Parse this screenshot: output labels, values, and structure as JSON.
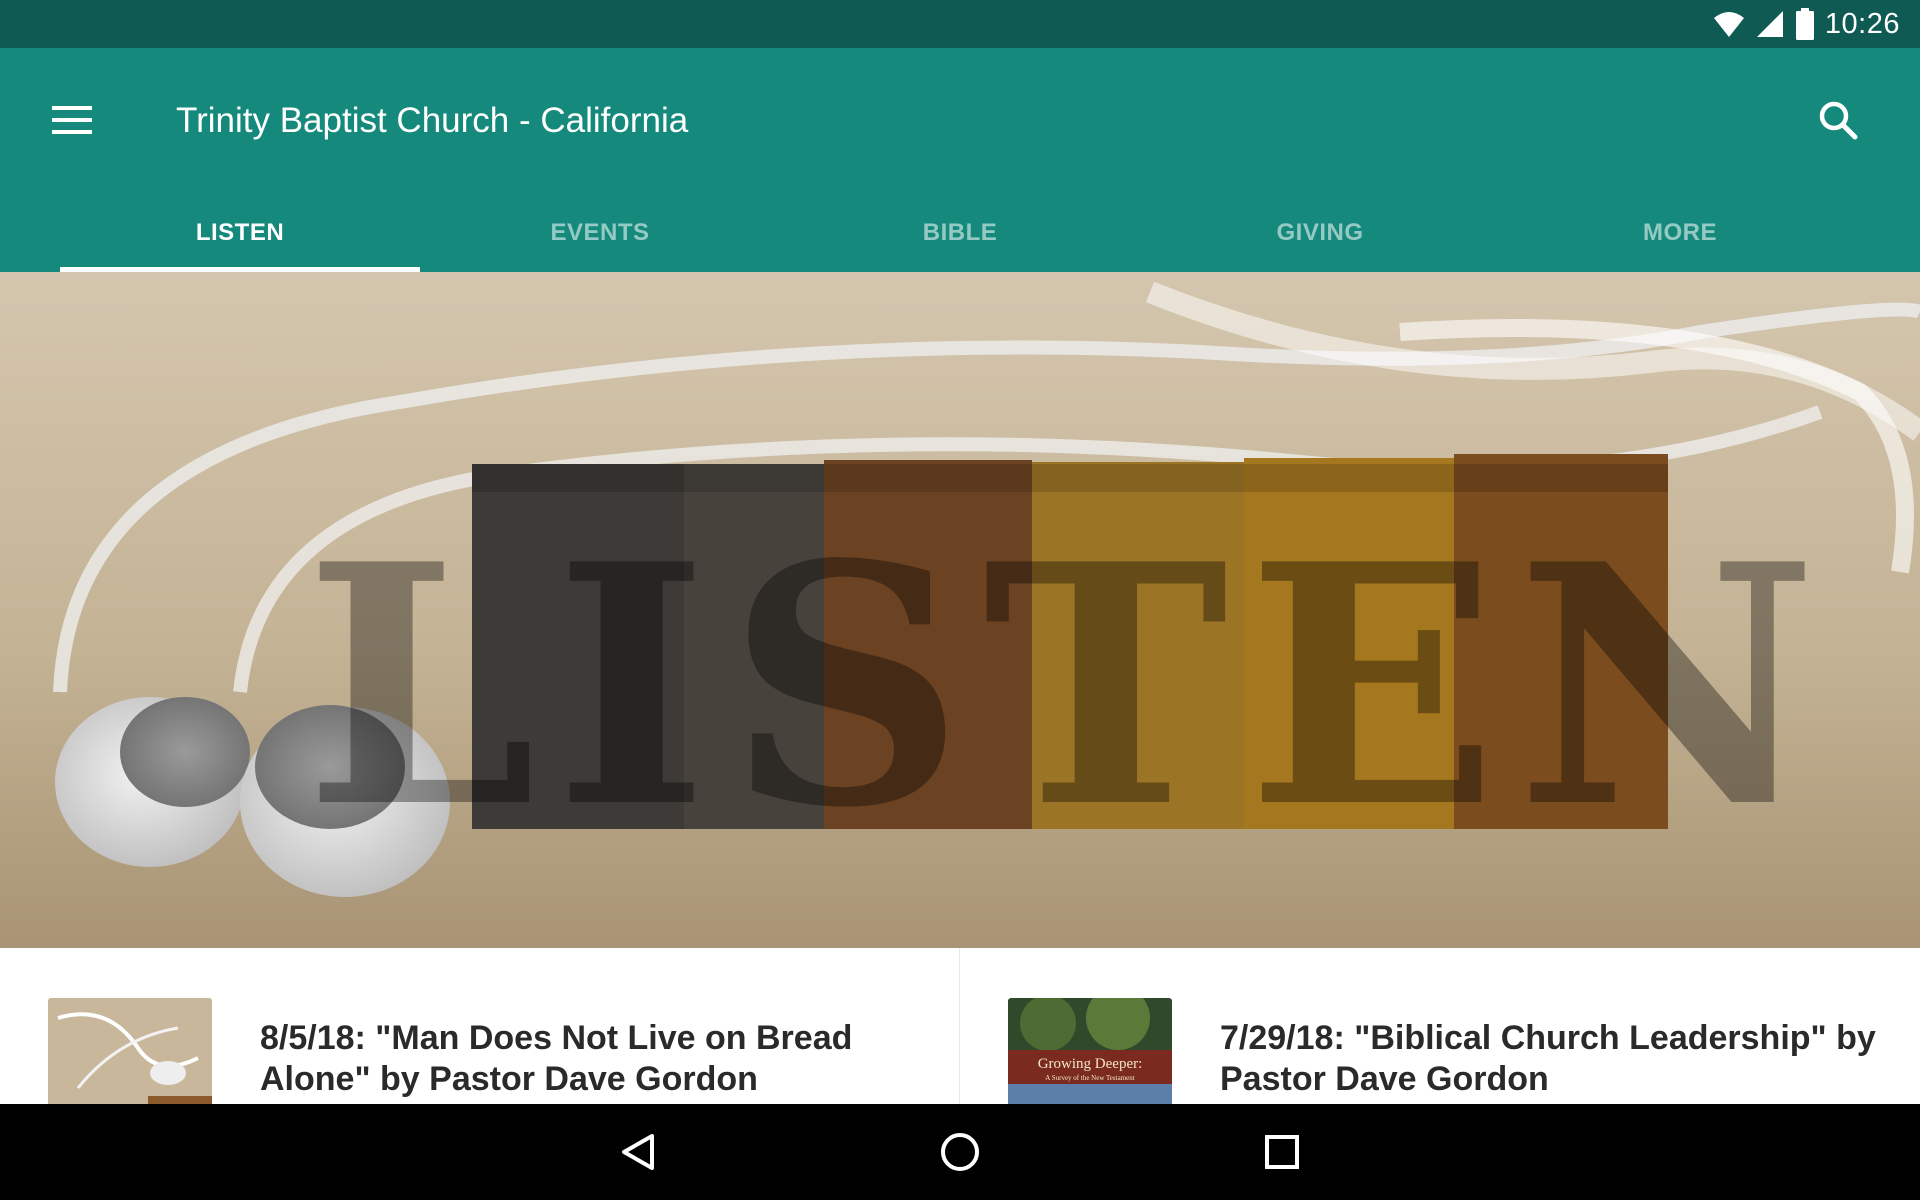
{
  "status_bar": {
    "time": "10:26",
    "icons": [
      "wifi-icon",
      "signal-icon",
      "battery-icon"
    ]
  },
  "app_bar": {
    "title": "Trinity Baptist Church - California",
    "menu_icon": "hamburger-menu-icon",
    "search_icon": "search-icon"
  },
  "tabs": [
    {
      "label": "LISTEN",
      "active": true
    },
    {
      "label": "EVENTS",
      "active": false
    },
    {
      "label": "BIBLE",
      "active": false
    },
    {
      "label": "GIVING",
      "active": false
    },
    {
      "label": "MORE",
      "active": false
    }
  ],
  "hero": {
    "word": "LISTEN"
  },
  "sermons": [
    {
      "title": "8/5/18: \"Man Does Not Live on Bread Alone\" by Pastor Dave Gordon"
    },
    {
      "title": "7/29/18: \"Biblical Church Leadership\" by Pastor Dave Gordon",
      "thumb_text": "Growing Deeper:",
      "thumb_subtext": "A Survey of the New Testament"
    }
  ],
  "nav_bar": {
    "icons": [
      "back-icon",
      "home-icon",
      "recents-icon"
    ]
  },
  "colors": {
    "status_bar": "#0f5a52",
    "app_bar": "#14897c",
    "nav_bar": "#000000"
  }
}
